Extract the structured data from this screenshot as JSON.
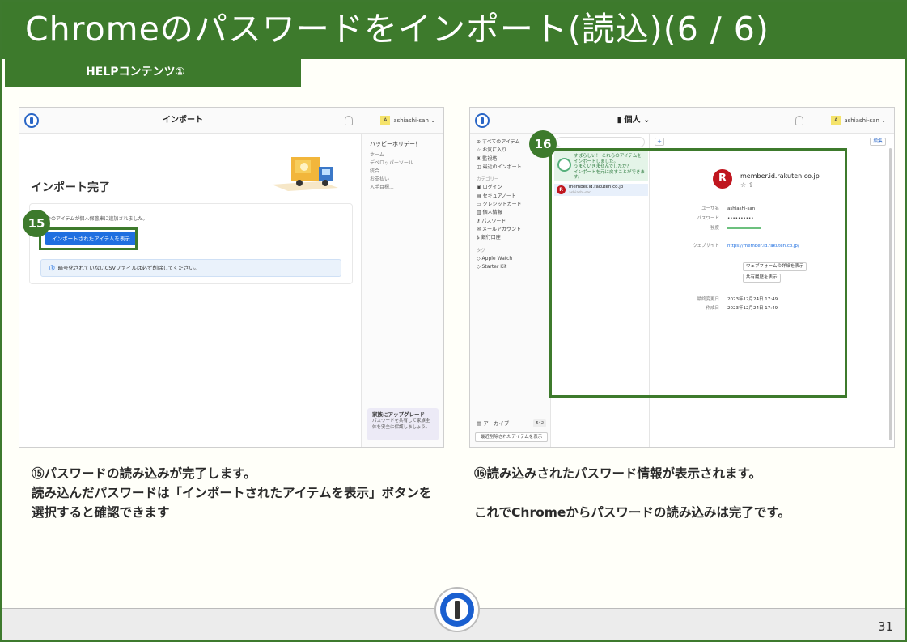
{
  "header": {
    "title": "Chromeのパスワードをインポート(読込)(6 / 6)",
    "section_tab": "HELPコンテンツ①"
  },
  "left_screenshot": {
    "window_title": "インポート",
    "user": "ashiashi-san",
    "user_initial": "A",
    "done_heading": "インポート完了",
    "added_message": "件のアイテムが個人保管庫に追加されました。",
    "view_button": "インポートされたアイテムを表示",
    "info_icon": "ⓘ",
    "info_text": "暗号化されていないCSVファイルは必ず削除してください。",
    "badge": "15",
    "right_panel": {
      "heading": "ハッピーホリデー！",
      "items": [
        "ホーム",
        "デベロッパーツール",
        "統合",
        "お支払い",
        "入手目標..."
      ]
    },
    "upgrade": {
      "title": "家族にアップグレード",
      "text": "パスワードを共有して家族全体を安全に保護しましょう。"
    }
  },
  "right_screenshot": {
    "vault_label": "個人",
    "user": "ashiashi-san",
    "user_initial": "A",
    "badge": "16",
    "sidebar": {
      "items": [
        "すべてのアイテム",
        "お気に入り",
        "監視塔",
        "最近のインポート"
      ],
      "categories_label": "カテゴリー",
      "categories": [
        "ログイン",
        "セキュアノート",
        "クレジットカード",
        "個人情報",
        "パスワード",
        "メールアカウント",
        "銀行口座"
      ],
      "tags_label": "タグ",
      "tags": [
        "Apple Watch",
        "Starter Kit"
      ],
      "archive_label": "アーカイブ",
      "archive_count": "542",
      "archive_button": "最近削除されたアイテムを表示"
    },
    "notice": {
      "line1": "すばらしい！ これらのアイテムを",
      "line2": "インポートしました。",
      "line3": "うまくいきませんでしたか？",
      "line4": "インポートを元に戻すことができます。"
    },
    "list_item": {
      "title": "member.id.rakuten.co.jp",
      "subtitle": "ashiashi-san"
    },
    "detail": {
      "plus": "+",
      "edit": "編集",
      "site": "member.id.rakuten.co.jp",
      "icons": "☆ ⇪",
      "username_label": "ユーザ名",
      "username": "ashiashi-san",
      "password_label": "パスワード",
      "password": "••••••••••",
      "strength_label": "強度",
      "website_label": "ウェブサイト",
      "website": "https://member.id.rakuten.co.jp/",
      "form_button": "ウェブフォームの詳細を表示",
      "history_button": "共有履歴を表示",
      "modified_label": "最終変更日",
      "modified": "2023年12月24日 17:49",
      "created_label": "作成日",
      "created": "2023年12月24日 17:49"
    }
  },
  "captions": {
    "left_line1": "⑮パスワードの読み込みが完了します。",
    "left_line2": "読み込んだパスワードは「インポートされたアイテムを表示」ボタンを選択すると確認できます",
    "right_line1": "⑯読み込みされたパスワード情報が表示されます。",
    "right_line2": "これでChromeからパスワードの読み込みは完了です。"
  },
  "footer": {
    "page_number": "31"
  },
  "colors": {
    "brand_green": "#3d7a2c",
    "accent_blue": "#1f6fe0"
  }
}
